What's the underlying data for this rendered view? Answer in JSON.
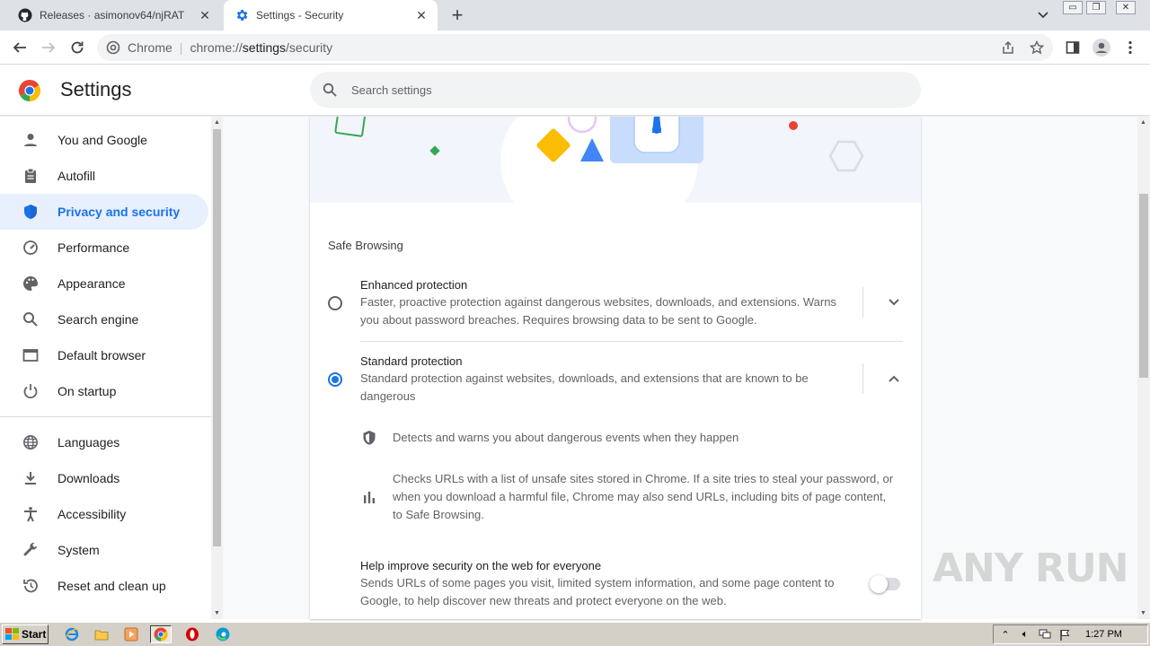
{
  "browser": {
    "tabs": [
      {
        "title": "Releases · asimonov64/njRAT",
        "icon": "github-icon",
        "active": false
      },
      {
        "title": "Settings - Security",
        "icon": "gear-icon",
        "active": true
      }
    ],
    "new_tab": "+",
    "omnibox": {
      "chip": "Chrome",
      "separator": "|",
      "url_prefix": "chrome://",
      "url_host": "settings",
      "url_path": "/security"
    }
  },
  "settings": {
    "title": "Settings",
    "search_placeholder": "Search settings",
    "nav": [
      {
        "label": "You and Google",
        "icon": "person-icon"
      },
      {
        "label": "Autofill",
        "icon": "clipboard-icon"
      },
      {
        "label": "Privacy and security",
        "icon": "shield-icon",
        "selected": true
      },
      {
        "label": "Performance",
        "icon": "gauge-icon"
      },
      {
        "label": "Appearance",
        "icon": "palette-icon"
      },
      {
        "label": "Search engine",
        "icon": "search-icon"
      },
      {
        "label": "Default browser",
        "icon": "browser-window-icon"
      },
      {
        "label": "On startup",
        "icon": "power-icon"
      },
      {
        "label": "Languages",
        "icon": "globe-icon"
      },
      {
        "label": "Downloads",
        "icon": "download-icon"
      },
      {
        "label": "Accessibility",
        "icon": "accessibility-icon"
      },
      {
        "label": "System",
        "icon": "wrench-icon"
      },
      {
        "label": "Reset and clean up",
        "icon": "restore-icon"
      }
    ]
  },
  "safe_browsing": {
    "section_title": "Safe Browsing",
    "enhanced": {
      "label": "Enhanced protection",
      "description": "Faster, proactive protection against dangerous websites, downloads, and extensions. Warns you about password breaches. Requires browsing data to be sent to Google.",
      "selected": false
    },
    "standard": {
      "label": "Standard protection",
      "description": "Standard protection against websites, downloads, and extensions that are known to be dangerous",
      "selected": true,
      "details": [
        "Detects and warns you about dangerous events when they happen",
        "Checks URLs with a list of unsafe sites stored in Chrome. If a site tries to steal your password, or when you download a harmful file, Chrome may also send URLs, including bits of page content, to Safe Browsing."
      ]
    },
    "help_improve": {
      "label": "Help improve security on the web for everyone",
      "description": "Sends URLs of some pages you visit, limited system information, and some page content to Google, to help discover new threats and protect everyone on the web.",
      "enabled": false
    }
  },
  "watermark": "ANY RUN",
  "taskbar": {
    "start_label": "Start",
    "clock": "1:27 PM"
  },
  "colors": {
    "accent": "#1a73e8",
    "selected_bg": "#e8f0fe"
  }
}
